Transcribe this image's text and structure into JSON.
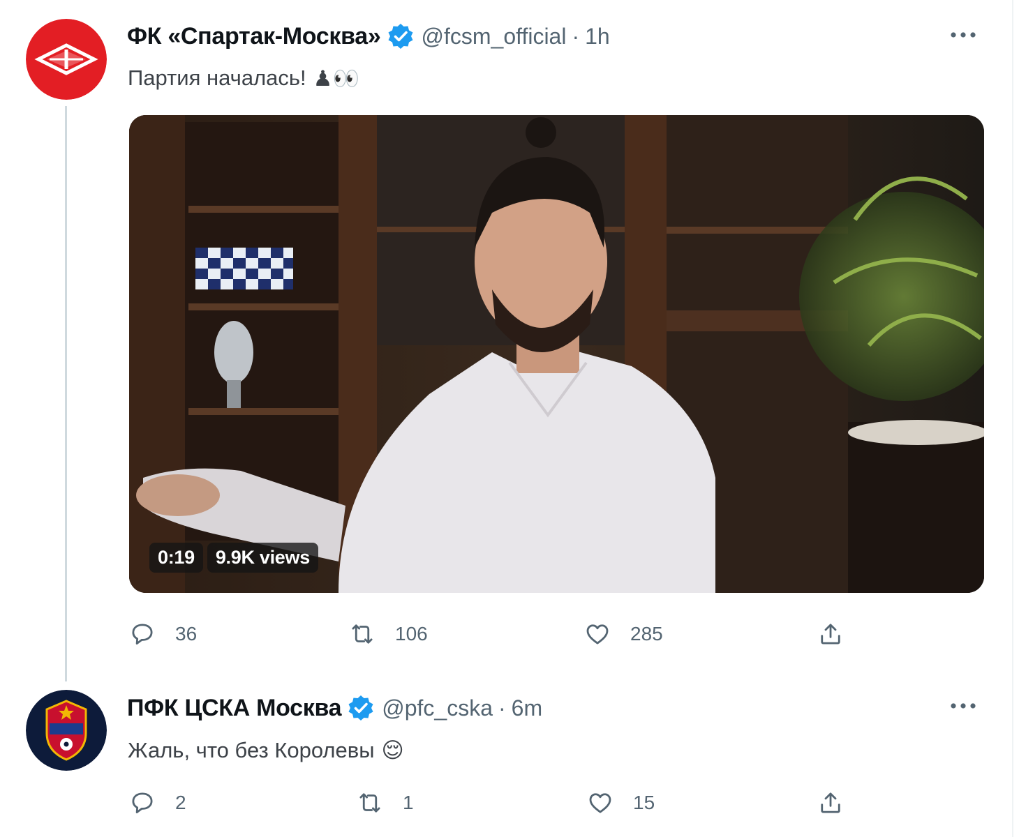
{
  "tweets": [
    {
      "display_name": "ФК «Спартак-Москва»",
      "handle": "@fcsm_official",
      "separator": "·",
      "time": "1h",
      "text": "Партия началась!",
      "emoji": "♟👀",
      "avatar_icon": "spartak-logo",
      "media": {
        "duration": "0:19",
        "views": "9.9K views"
      },
      "stats": {
        "replies": "36",
        "retweets": "106",
        "likes": "285"
      }
    },
    {
      "display_name": "ПФК ЦСКА Москва",
      "handle": "@pfc_cska",
      "separator": "·",
      "time": "6m",
      "text": "Жаль, что без Королевы",
      "emoji": "😌",
      "avatar_icon": "cska-logo",
      "stats": {
        "replies": "2",
        "retweets": "1",
        "likes": "15"
      }
    }
  ],
  "colors": {
    "verified_blue": "#1d9bf0",
    "spartak_red": "#e31e24",
    "cska_navy": "#0d1b3a",
    "meta_gray": "#536471"
  },
  "icons": [
    "reply-icon",
    "retweet-icon",
    "like-icon",
    "share-icon",
    "more-icon",
    "verified-badge-icon"
  ]
}
